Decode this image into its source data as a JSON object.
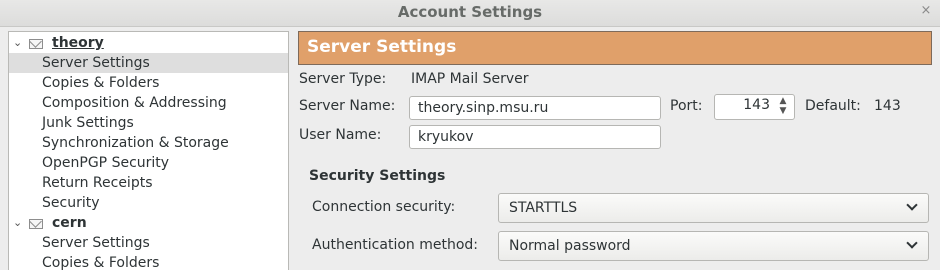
{
  "window": {
    "title": "Account Settings",
    "close_glyph": "×"
  },
  "sidebar": {
    "accounts": [
      {
        "name": "theory",
        "expanded": true,
        "icon": "mail-icon",
        "items": [
          "Server Settings",
          "Copies & Folders",
          "Composition & Addressing",
          "Junk Settings",
          "Synchronization & Storage",
          "OpenPGP Security",
          "Return Receipts",
          "Security"
        ],
        "selected_item": "Server Settings"
      },
      {
        "name": "cern",
        "expanded": true,
        "icon": "mail-icon",
        "items": [
          "Server Settings",
          "Copies & Folders"
        ]
      }
    ]
  },
  "main": {
    "banner_title": "Server Settings",
    "banner_color": "#e0a06a",
    "server_type_label": "Server Type:",
    "server_type_value": "IMAP Mail Server",
    "server_name_label": "Server Name:",
    "server_name_value": "theory.sinp.msu.ru",
    "port_label": "Port:",
    "port_value": "143",
    "default_label": "Default:",
    "default_value": "143",
    "user_name_label": "User Name:",
    "user_name_value": "kryukov",
    "security_title": "Security Settings",
    "connection_security_label": "Connection security:",
    "connection_security_value": "STARTTLS",
    "auth_method_label": "Authentication method:",
    "auth_method_value": "Normal password"
  }
}
